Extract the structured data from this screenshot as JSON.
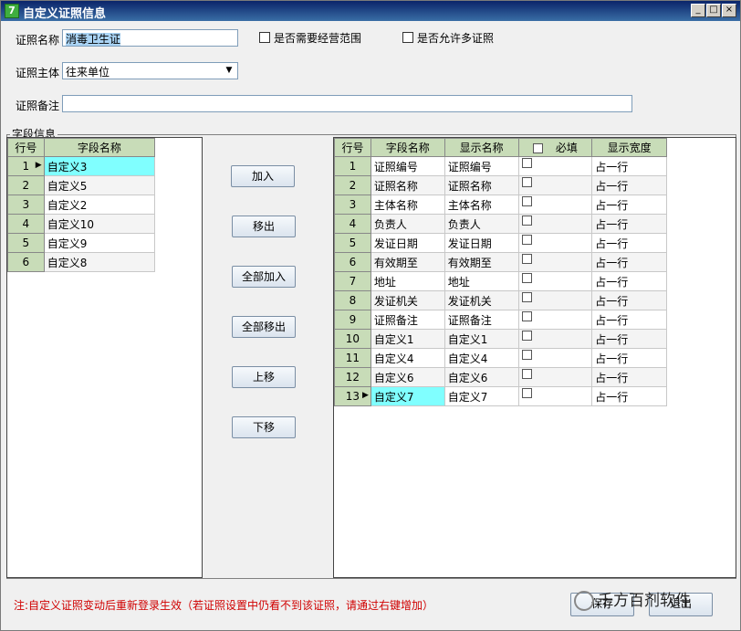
{
  "window": {
    "title": "自定义证照信息",
    "icon_name": "app-icon",
    "controls": {
      "minimize": "_",
      "maximize": "□",
      "close": "×"
    }
  },
  "form": {
    "cert_name_label": "证照名称",
    "cert_name_value": "消毒卫生证",
    "need_scope_label": "是否需要经营范围",
    "need_scope_checked": false,
    "allow_multi_label": "是否允许多证照",
    "allow_multi_checked": false,
    "subject_label": "证照主体",
    "subject_value": "往来单位",
    "remark_label": "证照备注",
    "remark_value": ""
  },
  "field_group": {
    "label": "字段信息",
    "left_grid": {
      "headers": [
        "行号",
        "字段名称"
      ],
      "rows": [
        {
          "no": "1",
          "name": "自定义3"
        },
        {
          "no": "2",
          "name": "自定义5"
        },
        {
          "no": "3",
          "name": "自定义2"
        },
        {
          "no": "4",
          "name": "自定义10"
        },
        {
          "no": "5",
          "name": "自定义9"
        },
        {
          "no": "6",
          "name": "自定义8"
        }
      ],
      "current_row": 0
    },
    "buttons": {
      "add": "加入",
      "remove": "移出",
      "add_all": "全部加入",
      "remove_all": "全部移出",
      "move_up": "上移",
      "move_down": "下移"
    },
    "right_grid": {
      "headers": [
        "行号",
        "字段名称",
        "显示名称",
        "必填",
        "显示宽度"
      ],
      "rows": [
        {
          "no": "1",
          "field": "证照编号",
          "display": "证照编号",
          "required": false,
          "width": "占一行"
        },
        {
          "no": "2",
          "field": "证照名称",
          "display": "证照名称",
          "required": false,
          "width": "占一行"
        },
        {
          "no": "3",
          "field": "主体名称",
          "display": "主体名称",
          "required": false,
          "width": "占一行"
        },
        {
          "no": "4",
          "field": "负责人",
          "display": "负责人",
          "required": false,
          "width": "占一行"
        },
        {
          "no": "5",
          "field": "发证日期",
          "display": "发证日期",
          "required": false,
          "width": "占一行"
        },
        {
          "no": "6",
          "field": "有效期至",
          "display": "有效期至",
          "required": false,
          "width": "占一行"
        },
        {
          "no": "7",
          "field": "地址",
          "display": "地址",
          "required": false,
          "width": "占一行"
        },
        {
          "no": "8",
          "field": "发证机关",
          "display": "发证机关",
          "required": false,
          "width": "占一行"
        },
        {
          "no": "9",
          "field": "证照备注",
          "display": "证照备注",
          "required": false,
          "width": "占一行"
        },
        {
          "no": "10",
          "field": "自定义1",
          "display": "自定义1",
          "required": false,
          "width": "占一行"
        },
        {
          "no": "11",
          "field": "自定义4",
          "display": "自定义4",
          "required": false,
          "width": "占一行"
        },
        {
          "no": "12",
          "field": "自定义6",
          "display": "自定义6",
          "required": false,
          "width": "占一行"
        },
        {
          "no": "13",
          "field": "自定义7",
          "display": "自定义7",
          "required": false,
          "width": "占一行"
        }
      ],
      "current_row": 12
    }
  },
  "footer": {
    "note": "注:自定义证照变动后重新登录生效（若证照设置中仍看不到该证照，请通过右键增加）",
    "save": "保存",
    "exit": "退出",
    "watermark": "千方百剂软件"
  }
}
